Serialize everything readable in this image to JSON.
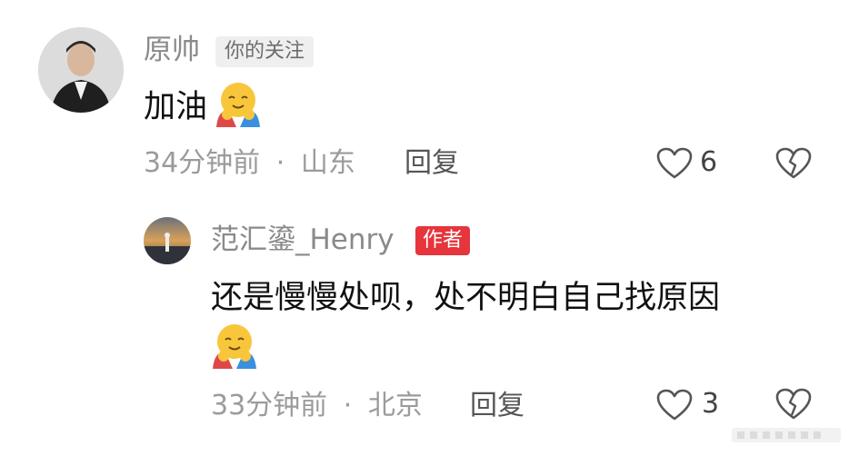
{
  "comments": [
    {
      "author": "原帅",
      "badge": "你的关注",
      "text": "加油",
      "emoji": "hug-emoji",
      "time": "34分钟前",
      "location": "山东",
      "reply_label": "回复",
      "likes": "6"
    },
    {
      "author": "范汇鎏_Henry",
      "badge": "作者",
      "text": "还是慢慢处呗，处不明白自己找原因",
      "emoji": "hug-emoji",
      "time": "33分钟前",
      "location": "北京",
      "reply_label": "回复",
      "likes": "3"
    }
  ],
  "meta_separator": "·",
  "colors": {
    "author_badge": "#e6353c",
    "follow_badge": "#efefef",
    "meta_text": "#9b9b9b"
  }
}
